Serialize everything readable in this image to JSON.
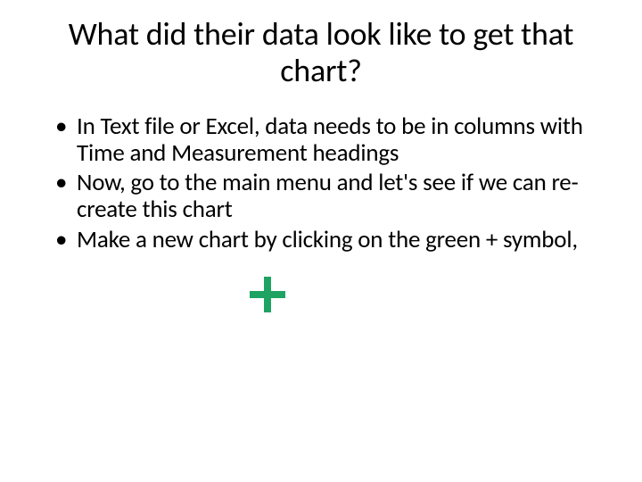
{
  "title": "What did their data look like to get that chart?",
  "bullets": [
    "In Text file or Excel, data needs to be in columns with Time and Measurement headings",
    "Now, go to the main menu and let's see if we can re-create this chart",
    "Make a new chart by clicking on the green + symbol,"
  ],
  "plus_color": "#1ea362"
}
